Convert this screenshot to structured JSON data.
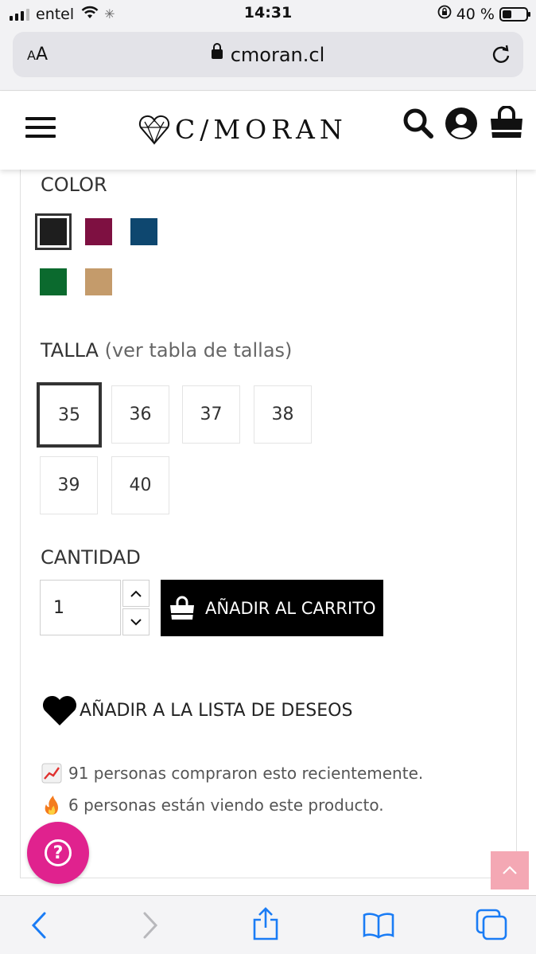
{
  "status_bar": {
    "carrier": "entel",
    "time": "14:31",
    "battery": "40 %",
    "battery_level": 0.4
  },
  "browser": {
    "text_size_label": "AA",
    "url": "cmoran.cl"
  },
  "header": {
    "logo_text": "C/MORAN"
  },
  "product": {
    "color_label": "COLOR",
    "colors": [
      "#1e1e1e",
      "#7e1041",
      "#0e476f",
      "#0b6a2e",
      "#c49b6b"
    ],
    "size_label": "TALLA",
    "size_chart_link": "(ver tabla de tallas)",
    "sizes": [
      "35",
      "36",
      "37",
      "38",
      "39",
      "40"
    ],
    "selected_size": "35",
    "quantity_label": "CANTIDAD",
    "quantity_value": "1",
    "add_to_cart": "AÑADIR AL CARRITO",
    "wishlist": "AÑADIR A LA LISTA DE DESEOS",
    "stat_purchased": "91 personas compraron esto recientemente.",
    "stat_viewing": "6 personas están viendo este producto."
  },
  "colors": {
    "help_button": "#e0228e",
    "back_to_top": "#f4a8b4",
    "ios_blue": "#1a7cf5"
  }
}
